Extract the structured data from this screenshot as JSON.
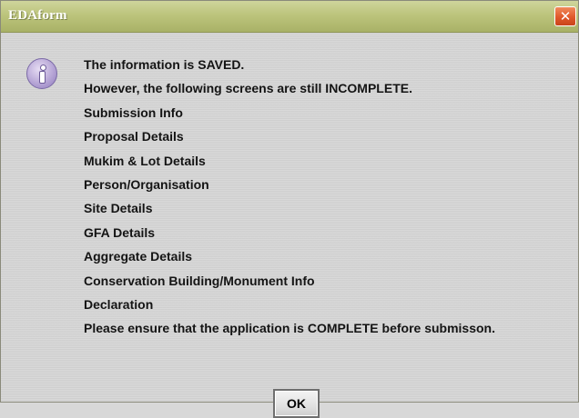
{
  "window": {
    "title": "EDAform",
    "close_label": "✕"
  },
  "dialog": {
    "icon": "information-icon",
    "lines": [
      "The information is SAVED.",
      "However, the following screens are still INCOMPLETE.",
      "Submission Info",
      "Proposal Details",
      "Mukim & Lot Details",
      "Person/Organisation",
      "Site Details",
      "GFA Details",
      "Aggregate Details",
      "Conservation Building/Monument Info",
      "Declaration",
      "Please ensure that the application is COMPLETE before submisson."
    ],
    "ok_label": "OK"
  },
  "colors": {
    "titlebar": "#bcc47c",
    "close_button": "#e0582a",
    "background": "#d6d6d6"
  }
}
